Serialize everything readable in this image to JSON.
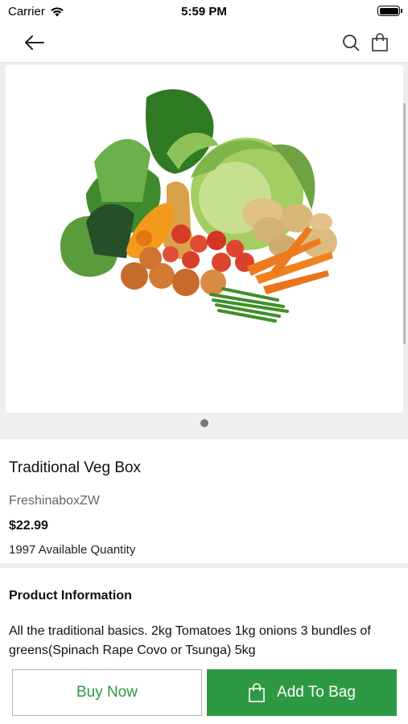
{
  "status": {
    "carrier": "Carrier",
    "time": "5:59 PM"
  },
  "nav": {
    "back_icon": "arrow-left-icon",
    "search_icon": "search-icon",
    "bag_icon": "shopping-bag-icon"
  },
  "carousel": {
    "image": "mixed-vegetables-photo",
    "current_page": 1,
    "page_count": 1
  },
  "product": {
    "title": "Traditional Veg Box",
    "vendor": "FreshinaboxZW",
    "price": "$22.99",
    "quantity": "1997 Available Quantity"
  },
  "info": {
    "heading": "Product Information",
    "description": "All the traditional basics. 2kg Tomatoes 1kg onions 3 bundles of greens(Spinach Rape Covo or Tsunga) 5kg"
  },
  "actions": {
    "buy_now": "Buy Now",
    "add_to_bag": "Add To Bag"
  },
  "colors": {
    "accent": "#2e9944",
    "background": "#efeff2"
  }
}
